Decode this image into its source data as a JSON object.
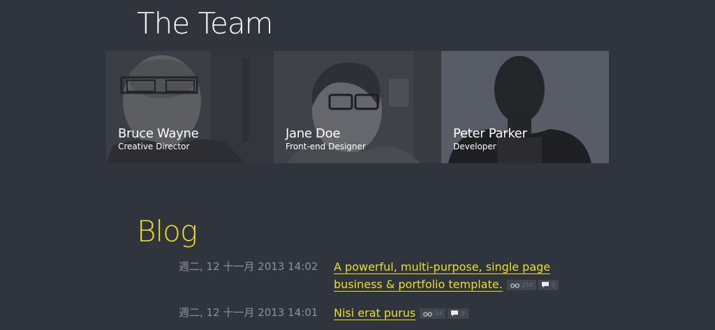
{
  "team": {
    "title": "The Team",
    "members": [
      {
        "name": "Bruce Wayne",
        "role": "Creative Director"
      },
      {
        "name": "Jane Doe",
        "role": "Front-end Designer"
      },
      {
        "name": "Peter Parker",
        "role": "Developer"
      }
    ]
  },
  "blog": {
    "title": "Blog",
    "posts": [
      {
        "date": "週二, 12 十一月 2013 14:02",
        "title": "A powerful, multi-purpose, single page business & portfolio template.",
        "views": "210",
        "comments": "0",
        "views_icon": "glasses-icon",
        "comments_icon": "comment-icon"
      },
      {
        "date": "週二, 12 十一月 2013 14:01",
        "title": "Nisi erat purus",
        "views": "24",
        "comments": "0",
        "views_icon": "glasses-icon",
        "comments_icon": "comment-icon"
      }
    ]
  },
  "colors": {
    "background": "#2f343d",
    "accent": "#ecdf2c",
    "text": "#ffffff",
    "muted": "#8d929a"
  }
}
